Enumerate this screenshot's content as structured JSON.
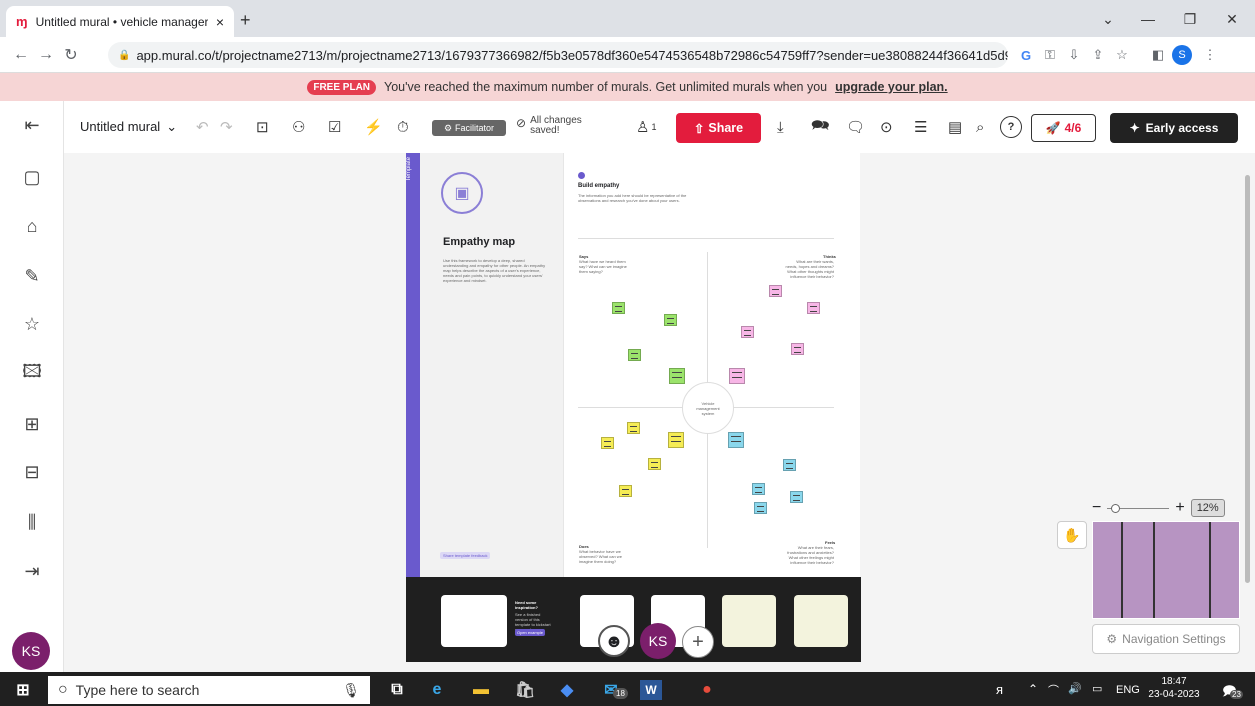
{
  "browser": {
    "tab_title": "Untitled mural • vehicle manager",
    "tab_close": "×",
    "new_tab": "+",
    "url": "app.mural.co/t/projectname2713/m/projectname2713/1679377366982/f5b3e0578df360e5474536548b72986c54759ff7?sender=ue38088244f36641d5d9...",
    "profile_initial": "S"
  },
  "banner": {
    "badge": "FREE PLAN",
    "message": "You've reached the maximum number of murals. Get unlimited murals when you",
    "link": "upgrade your plan."
  },
  "toolbar": {
    "mural_name": "Untitled mural",
    "facilitator": "Facilitator",
    "saved_status": "All changes saved!",
    "participants": "1",
    "share": "Share",
    "launch_progress": "4/6",
    "early_access": "Early access"
  },
  "template": {
    "vertical_label": "Template",
    "title": "Empathy map",
    "description": "Use this framework to develop a deep, shared understanding and empathy for other people. An empathy map helps describe the aspects of a user's experience, needs and pain points, to quickly understand your users' experience and mindset.",
    "feedback": "Share template feedback",
    "inspired_title": "Need some inspiration?",
    "inspired_text": "See a finished version of this template to kickstart your work.",
    "inspired_btn": "Open example"
  },
  "canvas": {
    "heading": "Build empathy",
    "subheading": "The information you add here should be representative of the observations and research you've done about your users.",
    "q_says": "Says",
    "q_thinks": "Thinks",
    "q_does": "Does",
    "q_feels": "Feels",
    "center": "Vehicle management system",
    "says_desc": "What have we heard them say? What can we imagine them saying?",
    "thinks_desc": "What are their wants, needs, hopes and dreams? What other thoughts might influence their behavior?",
    "does_desc": "What behavior have we observed? What can we imagine them doing?",
    "feels_desc": "What are their fears, frustrations and anxieties? What other feelings might influence their behavior?"
  },
  "navigator": {
    "zoom": "12%",
    "settings": "Navigation Settings"
  },
  "user": {
    "initials": "KS"
  },
  "colors": {
    "accent": "#e31c3d",
    "template_stripe": "#6a5acd",
    "minimap": "#b794c2",
    "note_green": "#9be36b",
    "note_pink": "#f7b6e6",
    "note_yellow": "#f5ec55",
    "note_blue": "#8ad7ec"
  },
  "taskbar": {
    "search_placeholder": "Type here to search",
    "mail_badge": "18",
    "lang": "ENG",
    "time": "18:47",
    "date": "23-04-2023",
    "notif_count": "23"
  }
}
